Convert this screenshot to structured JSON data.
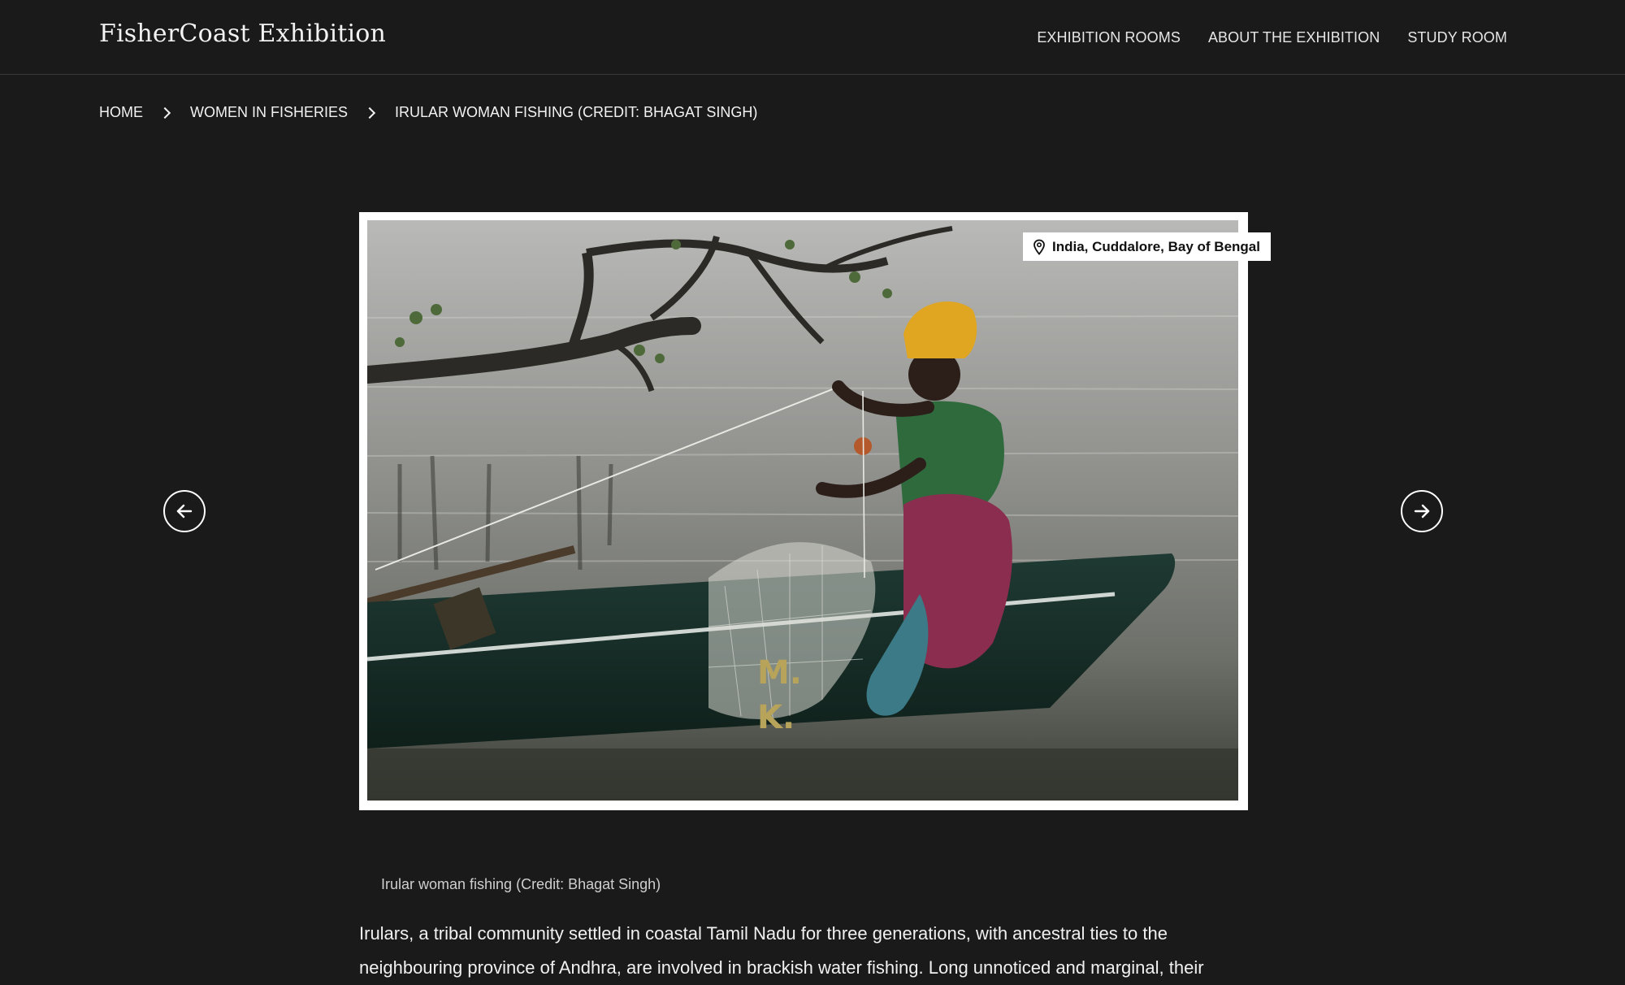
{
  "header": {
    "site_title": "FisherCoast Exhibition",
    "nav": [
      {
        "label": "EXHIBITION ROOMS"
      },
      {
        "label": "ABOUT THE EXHIBITION"
      },
      {
        "label": "STUDY ROOM"
      }
    ]
  },
  "breadcrumb": {
    "items": [
      {
        "label": "HOME"
      },
      {
        "label": "WOMEN IN FISHERIES"
      },
      {
        "label": "IRULAR WOMAN FISHING (CREDIT: BHAGAT SINGH)"
      }
    ]
  },
  "figure": {
    "location": "India, Cuddalore, Bay of Bengal",
    "caption": "Irular woman fishing (Credit: Bhagat Singh)",
    "image_icon": "photo-of-woman-fishing-from-boat"
  },
  "gallery": {
    "prev_icon": "arrow-left-icon",
    "next_icon": "arrow-right-icon"
  },
  "description": "Irulars, a tribal community settled in coastal Tamil Nadu for three generations, with ancestral ties to the neighbouring province of Andhra, are involved in brackish water fishing. Long unnoticed and marginal, their",
  "colors": {
    "background": "#1a1a1a",
    "text": "#ffffff",
    "frame": "#ffffff"
  }
}
